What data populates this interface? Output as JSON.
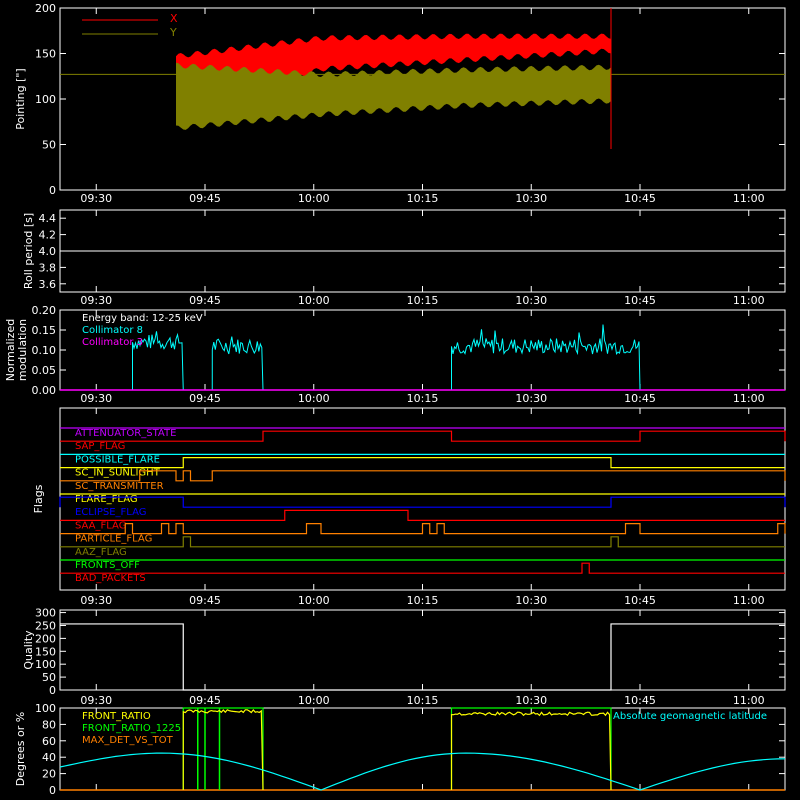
{
  "colors": {
    "background": "#000000",
    "axis": "#ffffff",
    "red": "#ff0000",
    "olive": "#808000",
    "cyan": "#00ffff",
    "magenta": "#ff00ff",
    "white": "#ffffff",
    "orange": "#ff8000",
    "yellow": "#ffff00",
    "green": "#00ff00",
    "blue": "#0000ff",
    "purple": "#c000ff"
  },
  "time_ticks": [
    "09:30",
    "09:45",
    "10:00",
    "10:15",
    "10:30",
    "10:45",
    "11:00"
  ],
  "chart_data": [
    {
      "name": "pointing",
      "type": "line",
      "ylabel": "Pointing [\"]",
      "ylim": [
        0,
        200
      ],
      "yticks": [
        0,
        50,
        100,
        150,
        200
      ],
      "legend": [
        "X",
        "Y"
      ],
      "series": [
        {
          "name": "X",
          "color": "red",
          "baseline": 127,
          "start": "09:41",
          "end": "10:41",
          "envelope_min": [
            75,
            130,
            140,
            150
          ],
          "envelope_max": [
            150,
            170,
            172,
            172
          ]
        },
        {
          "name": "Y",
          "color": "olive",
          "baseline": 127,
          "start": "09:41",
          "end": "10:41",
          "envelope_min": [
            65,
            80,
            90,
            95
          ],
          "envelope_max": [
            140,
            130,
            135,
            138
          ]
        }
      ]
    },
    {
      "name": "roll-period",
      "type": "line",
      "ylabel": "Roll period [s]",
      "ylim": [
        3.5,
        4.5
      ],
      "yticks": [
        "3.6",
        "3.8",
        "4.0",
        "4.2",
        "4.4"
      ],
      "series": [
        {
          "name": "roll",
          "color": "white",
          "value": 4.0
        }
      ]
    },
    {
      "name": "modulation",
      "type": "line",
      "ylabel_lines": [
        "Normalized",
        "modulation"
      ],
      "ylim": [
        0,
        0.2
      ],
      "yticks": [
        "0.00",
        "0.05",
        "0.10",
        "0.15",
        "0.20"
      ],
      "annotation": "Energy band: 12-25 keV",
      "legend": [
        "Collimator 8",
        "Collimator 3"
      ],
      "series": [
        {
          "name": "Collimator 8",
          "color": "cyan",
          "segments": [
            [
              "09:35",
              "09:42",
              0.12
            ],
            [
              "09:46",
              "09:53",
              0.11
            ],
            [
              "10:19",
              "10:45",
              0.11
            ]
          ]
        },
        {
          "name": "Collimator 3",
          "color": "magenta",
          "value": 0
        }
      ]
    },
    {
      "name": "flags",
      "type": "line",
      "ylabel": "Flags",
      "flags": [
        {
          "label": "ATTENUATOR_STATE",
          "color": "purple",
          "segments": []
        },
        {
          "label": "SAP_FLAG",
          "color": "red",
          "segments": [
            [
              "09:53",
              "10:19"
            ],
            [
              "10:45",
              "11:05"
            ]
          ]
        },
        {
          "label": "POSSIBLE_FLARE",
          "color": "cyan",
          "segments": []
        },
        {
          "label": "SC_IN_SUNLIGHT",
          "color": "yellow",
          "segments": [
            [
              "09:42",
              "10:41"
            ]
          ]
        },
        {
          "label": "SC_TRANSMITTER",
          "color": "orange",
          "segments": [
            [
              "09:36",
              "09:41"
            ],
            [
              "09:42",
              "09:43"
            ],
            [
              "09:46",
              "11:05"
            ]
          ]
        },
        {
          "label": "FLARE_FLAG",
          "color": "yellow",
          "segments": []
        },
        {
          "label": "ECLIPSE_FLAG",
          "color": "blue",
          "segments": [
            [
              "09:25",
              "09:42"
            ],
            [
              "10:41",
              "11:05"
            ]
          ]
        },
        {
          "label": "SAA_FLAG",
          "color": "red",
          "segments": [
            [
              "09:56",
              "10:13"
            ]
          ]
        },
        {
          "label": "PARTICLE_FLAG",
          "color": "orange",
          "segments": [
            [
              "09:34",
              "09:35"
            ],
            [
              "09:39",
              "09:40"
            ],
            [
              "09:41",
              "09:42"
            ],
            [
              "09:59",
              "10:01"
            ],
            [
              "10:15",
              "10:16"
            ],
            [
              "10:17",
              "10:18"
            ],
            [
              "10:43",
              "10:45"
            ],
            [
              "11:04",
              "11:05"
            ]
          ]
        },
        {
          "label": "AAZ_FLAG",
          "color": "olive",
          "segments": [
            [
              "09:42",
              "09:43"
            ],
            [
              "10:41",
              "10:42"
            ]
          ]
        },
        {
          "label": "FRONTS_OFF",
          "color": "green",
          "segments": []
        },
        {
          "label": "BAD_PACKETS",
          "color": "red",
          "segments": [
            [
              "10:37",
              "10:38"
            ]
          ]
        }
      ]
    },
    {
      "name": "quality",
      "type": "line",
      "ylabel": "Quality",
      "ylim": [
        0,
        310
      ],
      "yticks": [
        0,
        50,
        100,
        150,
        200,
        250,
        300
      ],
      "series": [
        {
          "name": "quality",
          "color": "white",
          "segments": [
            [
              "09:25",
              "09:42",
              256
            ],
            [
              "09:42",
              "10:41",
              0
            ],
            [
              "10:41",
              "11:05",
              256
            ]
          ]
        }
      ]
    },
    {
      "name": "status",
      "type": "line",
      "ylabel": "Degrees or %",
      "ylim": [
        0,
        100
      ],
      "yticks": [
        0,
        20,
        40,
        60,
        80,
        100
      ],
      "legend": [
        "FRONT_RATIO",
        "FRONT_RATIO_1225",
        "MAX_DET_VS_TOT"
      ],
      "legend_right": "Absolute geomagnetic latitude",
      "series": [
        {
          "name": "FRONT_RATIO",
          "color": "yellow",
          "segments": [
            [
              "09:42",
              "09:53",
              98
            ],
            [
              "10:19",
              "10:41",
              95
            ]
          ]
        },
        {
          "name": "FRONT_RATIO_1225",
          "color": "green",
          "segments": [
            [
              "09:42",
              "09:53",
              100
            ],
            [
              "10:19",
              "10:41",
              100
            ]
          ]
        },
        {
          "name": "MAX_DET_VS_TOT",
          "color": "orange",
          "value": 0
        },
        {
          "name": "Absolute geomagnetic latitude",
          "color": "cyan",
          "points": [
            [
              "09:25",
              28
            ],
            [
              "09:39",
              45
            ],
            [
              "10:01",
              0
            ],
            [
              "10:21",
              45
            ],
            [
              "10:45",
              0
            ],
            [
              "11:05",
              38
            ]
          ]
        }
      ]
    }
  ]
}
